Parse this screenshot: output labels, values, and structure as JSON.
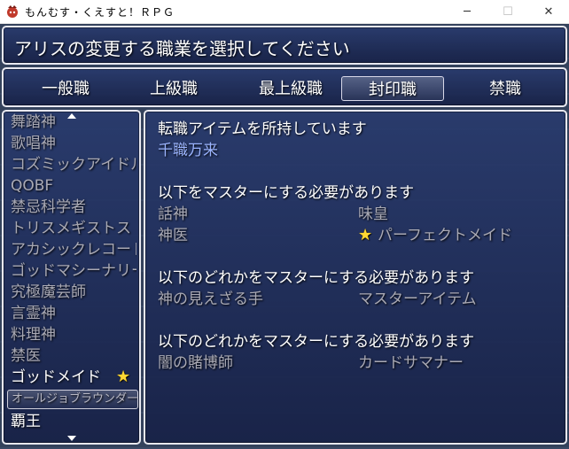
{
  "window": {
    "title": "もんむす・くえすと！ＲＰＧ",
    "minimize_symbol": "─",
    "maximize_symbol": "☐",
    "close_symbol": "✕"
  },
  "help": {
    "text": "アリスの変更する職業を選択してください"
  },
  "categories": [
    {
      "label": "一般職",
      "selected": false
    },
    {
      "label": "上級職",
      "selected": false
    },
    {
      "label": "最上級職",
      "selected": false
    },
    {
      "label": "封印職",
      "selected": true
    },
    {
      "label": "禁職",
      "selected": false
    }
  ],
  "job_list": [
    {
      "label": "舞踏神"
    },
    {
      "label": "歌唱神"
    },
    {
      "label": "コズミックアイドル"
    },
    {
      "label": "QOBF"
    },
    {
      "label": "禁忌科学者"
    },
    {
      "label": "トリスメギストス"
    },
    {
      "label": "アカシックレコード"
    },
    {
      "label": "ゴッドマシーナリー"
    },
    {
      "label": "究極魔芸師"
    },
    {
      "label": "言霊神"
    },
    {
      "label": "料理神"
    },
    {
      "label": "禁医"
    },
    {
      "label": "ゴッドメイド",
      "mastered": true
    },
    {
      "label": "オールジョブラウンダー",
      "selected": true
    },
    {
      "label": "覇王",
      "bright": true
    }
  ],
  "star_symbol": "★",
  "requirements": {
    "item_header": "転職アイテムを所持しています",
    "item_name": "千職万来",
    "section1_header": "以下をマスターにする必要があります",
    "section1_jobs": [
      "話神",
      "味皇",
      "神医",
      "パーフェクトメイド"
    ],
    "section2_header": "以下のどれかをマスターにする必要があります",
    "section2_jobs": [
      "神の見えざる手",
      "マスターアイテム"
    ],
    "section3_header": "以下のどれかをマスターにする必要があります",
    "section3_jobs": [
      "闇の賭博師",
      "カードサマナー"
    ]
  },
  "colors": {
    "unavailable_text": "#a9a9b4",
    "available_text": "#ffffff",
    "item_text": "#9bb4ff",
    "star": "#ffd733"
  }
}
